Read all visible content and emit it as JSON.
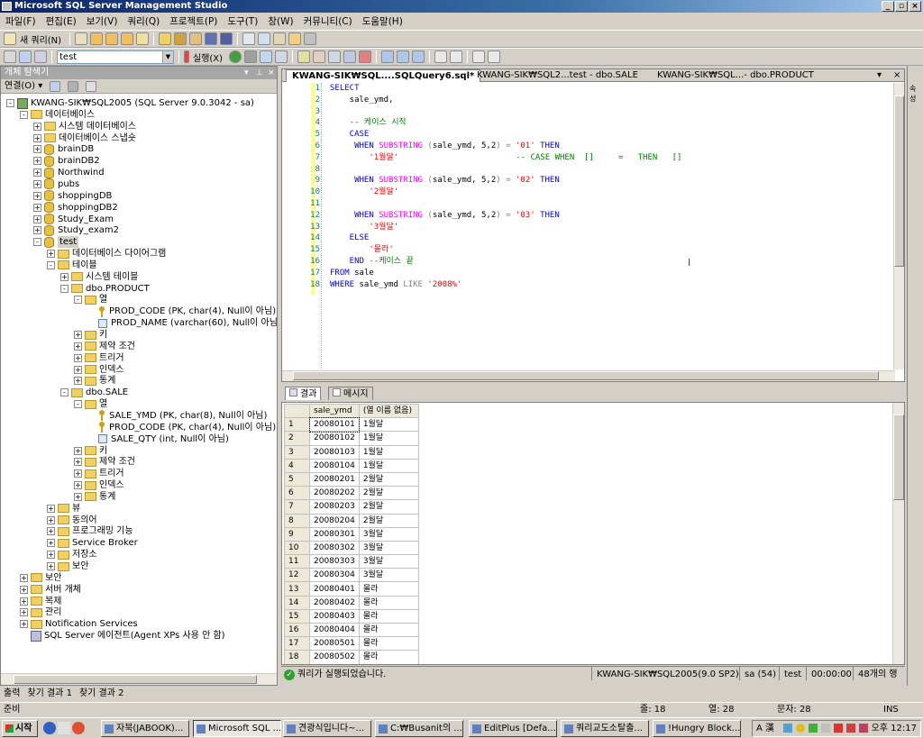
{
  "window": {
    "title": "Microsoft SQL Server Management Studio"
  },
  "menu": [
    "파일(F)",
    "편집(E)",
    "보기(V)",
    "쿼리(Q)",
    "프로젝트(P)",
    "도구(T)",
    "창(W)",
    "커뮤니티(C)",
    "도움말(H)"
  ],
  "toolbar1": {
    "new_query": "새 쿼리(N)"
  },
  "toolbar2": {
    "database": "test",
    "execute": "실행(X)"
  },
  "object_explorer": {
    "title": "개체 탐색기",
    "connect": "연결(O)",
    "tree": [
      {
        "label": "KWANG-SIK₩SQL2005 (SQL Server 9.0.3042 - sa)",
        "level": 0,
        "icon": "server-icon",
        "exp": "-"
      },
      {
        "label": "데이터베이스",
        "level": 1,
        "icon": "folder-icon",
        "exp": "-"
      },
      {
        "label": "시스템 데이터베이스",
        "level": 2,
        "icon": "folder-icon",
        "exp": "+"
      },
      {
        "label": "데이터베이스 스냅숏",
        "level": 2,
        "icon": "folder-icon",
        "exp": "+"
      },
      {
        "label": "brainDB",
        "level": 2,
        "icon": "database-icon",
        "exp": "+"
      },
      {
        "label": "brainDB2",
        "level": 2,
        "icon": "database-icon",
        "exp": "+"
      },
      {
        "label": "Northwind",
        "level": 2,
        "icon": "database-icon",
        "exp": "+"
      },
      {
        "label": "pubs",
        "level": 2,
        "icon": "database-icon",
        "exp": "+"
      },
      {
        "label": "shoppingDB",
        "level": 2,
        "icon": "database-icon",
        "exp": "+"
      },
      {
        "label": "shoppingDB2",
        "level": 2,
        "icon": "database-icon",
        "exp": "+"
      },
      {
        "label": "Study_Exam",
        "level": 2,
        "icon": "database-icon",
        "exp": "+"
      },
      {
        "label": "Study_exam2",
        "level": 2,
        "icon": "database-icon",
        "exp": "+"
      },
      {
        "label": "test",
        "level": 2,
        "icon": "database-icon",
        "exp": "-",
        "selected": true
      },
      {
        "label": "데이터베이스 다이어그램",
        "level": 3,
        "icon": "folder-icon",
        "exp": "+"
      },
      {
        "label": "테이블",
        "level": 3,
        "icon": "folder-icon",
        "exp": "-"
      },
      {
        "label": "시스템 테이블",
        "level": 4,
        "icon": "folder-icon",
        "exp": "+"
      },
      {
        "label": "dbo.PRODUCT",
        "level": 4,
        "icon": "table-icon",
        "exp": "-"
      },
      {
        "label": "열",
        "level": 5,
        "icon": "folder-icon",
        "exp": "-"
      },
      {
        "label": "PROD_CODE (PK, char(4), Null이 아님)",
        "level": 6,
        "icon": "key-icon",
        "exp": ""
      },
      {
        "label": "PROD_NAME (varchar(60), Null이 아님)",
        "level": 6,
        "icon": "column-icon",
        "exp": ""
      },
      {
        "label": "키",
        "level": 5,
        "icon": "folder-icon",
        "exp": "+"
      },
      {
        "label": "제약 조건",
        "level": 5,
        "icon": "folder-icon",
        "exp": "+"
      },
      {
        "label": "트리거",
        "level": 5,
        "icon": "folder-icon",
        "exp": "+"
      },
      {
        "label": "인덱스",
        "level": 5,
        "icon": "folder-icon",
        "exp": "+"
      },
      {
        "label": "통계",
        "level": 5,
        "icon": "folder-icon",
        "exp": "+"
      },
      {
        "label": "dbo.SALE",
        "level": 4,
        "icon": "table-icon",
        "exp": "-"
      },
      {
        "label": "열",
        "level": 5,
        "icon": "folder-icon",
        "exp": "-"
      },
      {
        "label": "SALE_YMD (PK, char(8), Null이 아님)",
        "level": 6,
        "icon": "key-icon",
        "exp": ""
      },
      {
        "label": "PROD_CODE (PK, char(4), Null이 아님)",
        "level": 6,
        "icon": "key-icon",
        "exp": ""
      },
      {
        "label": "SALE_QTY (int, Null이 아님)",
        "level": 6,
        "icon": "column-icon",
        "exp": ""
      },
      {
        "label": "키",
        "level": 5,
        "icon": "folder-icon",
        "exp": "+"
      },
      {
        "label": "제약 조건",
        "level": 5,
        "icon": "folder-icon",
        "exp": "+"
      },
      {
        "label": "트리거",
        "level": 5,
        "icon": "folder-icon",
        "exp": "+"
      },
      {
        "label": "인덱스",
        "level": 5,
        "icon": "folder-icon",
        "exp": "+"
      },
      {
        "label": "통계",
        "level": 5,
        "icon": "folder-icon",
        "exp": "+"
      },
      {
        "label": "뷰",
        "level": 3,
        "icon": "folder-icon",
        "exp": "+"
      },
      {
        "label": "동의어",
        "level": 3,
        "icon": "folder-icon",
        "exp": "+"
      },
      {
        "label": "프로그래밍 기능",
        "level": 3,
        "icon": "folder-icon",
        "exp": "+"
      },
      {
        "label": "Service Broker",
        "level": 3,
        "icon": "folder-icon",
        "exp": "+"
      },
      {
        "label": "저장소",
        "level": 3,
        "icon": "folder-icon",
        "exp": "+"
      },
      {
        "label": "보안",
        "level": 3,
        "icon": "folder-icon",
        "exp": "+"
      },
      {
        "label": "보안",
        "level": 1,
        "icon": "folder-icon",
        "exp": "+"
      },
      {
        "label": "서버 개체",
        "level": 1,
        "icon": "folder-icon",
        "exp": "+"
      },
      {
        "label": "복제",
        "level": 1,
        "icon": "folder-icon",
        "exp": "+"
      },
      {
        "label": "관리",
        "level": 1,
        "icon": "folder-icon",
        "exp": "+"
      },
      {
        "label": "Notification Services",
        "level": 1,
        "icon": "folder-icon",
        "exp": "+"
      },
      {
        "label": "SQL Server 에이전트(Agent XPs 사용 안 함)",
        "level": 1,
        "icon": "agent-icon",
        "exp": ""
      }
    ]
  },
  "editor": {
    "tabs": [
      "KWANG-SIK₩SQL....SQLQuery6.sql*",
      "KWANG-SIK₩SQL2...test - dbo.SALE",
      "KWANG-SIK₩SQL...- dbo.PRODUCT"
    ],
    "lines": [
      [
        [
          "kw",
          "SELECT"
        ]
      ],
      [
        [
          "",
          "    sale_ymd,"
        ]
      ],
      [
        [
          "",
          ""
        ]
      ],
      [
        [
          "cm",
          "    -- 케이스 시작"
        ]
      ],
      [
        [
          "kw",
          "    CASE"
        ]
      ],
      [
        [
          "kw",
          "     WHEN "
        ],
        [
          "fn",
          "SUBSTRING"
        ],
        [
          "",
          " "
        ],
        [
          "gr",
          "("
        ],
        [
          "",
          "sale_ymd, 5,2"
        ],
        [
          "gr",
          ")"
        ],
        [
          "",
          " "
        ],
        [
          "gr",
          "="
        ],
        [
          "",
          " "
        ],
        [
          "str",
          "'01'"
        ],
        [
          "",
          " "
        ],
        [
          "kw",
          "THEN"
        ]
      ],
      [
        [
          "str",
          "        '1월달'"
        ],
        [
          "",
          "                        "
        ],
        [
          "cm",
          "-- CASE WHEN  []     =   THEN   []"
        ]
      ],
      [
        [
          "",
          ""
        ]
      ],
      [
        [
          "kw",
          "     WHEN "
        ],
        [
          "fn",
          "SUBSTRING"
        ],
        [
          "",
          " "
        ],
        [
          "gr",
          "("
        ],
        [
          "",
          "sale_ymd, 5,2"
        ],
        [
          "gr",
          ")"
        ],
        [
          "",
          " "
        ],
        [
          "gr",
          "="
        ],
        [
          "",
          " "
        ],
        [
          "str",
          "'02'"
        ],
        [
          "",
          " "
        ],
        [
          "kw",
          "THEN"
        ]
      ],
      [
        [
          "str",
          "        '2월달'"
        ]
      ],
      [
        [
          "",
          ""
        ]
      ],
      [
        [
          "kw",
          "     WHEN "
        ],
        [
          "fn",
          "SUBSTRING"
        ],
        [
          "",
          " "
        ],
        [
          "gr",
          "("
        ],
        [
          "",
          "sale_ymd, 5,2"
        ],
        [
          "gr",
          ")"
        ],
        [
          "",
          " "
        ],
        [
          "gr",
          "="
        ],
        [
          "",
          " "
        ],
        [
          "str",
          "'03'"
        ],
        [
          "",
          " "
        ],
        [
          "kw",
          "THEN"
        ]
      ],
      [
        [
          "str",
          "        '3월달'"
        ]
      ],
      [
        [
          "kw",
          "    ELSE"
        ]
      ],
      [
        [
          "str",
          "        '몰라'"
        ]
      ],
      [
        [
          "kw",
          "    END "
        ],
        [
          "cm",
          "--케이스 끝"
        ]
      ],
      [
        [
          "kw",
          "FROM"
        ],
        [
          "",
          " sale"
        ]
      ],
      [
        [
          "kw",
          "WHERE"
        ],
        [
          "",
          " sale_ymd "
        ],
        [
          "gr",
          "LIKE"
        ],
        [
          "",
          " "
        ],
        [
          "str",
          "'2008%'"
        ]
      ]
    ]
  },
  "results": {
    "tabs": [
      "결과",
      "메시지"
    ],
    "columns": [
      "sale_ymd",
      "(열 이름 없음)"
    ],
    "rows": [
      [
        "1",
        "20080101",
        "1월달"
      ],
      [
        "2",
        "20080102",
        "1월달"
      ],
      [
        "3",
        "20080103",
        "1월달"
      ],
      [
        "4",
        "20080104",
        "1월달"
      ],
      [
        "5",
        "20080201",
        "2월달"
      ],
      [
        "6",
        "20080202",
        "2월달"
      ],
      [
        "7",
        "20080203",
        "2월달"
      ],
      [
        "8",
        "20080204",
        "2월달"
      ],
      [
        "9",
        "20080301",
        "3월달"
      ],
      [
        "10",
        "20080302",
        "3월달"
      ],
      [
        "11",
        "20080303",
        "3월달"
      ],
      [
        "12",
        "20080304",
        "3월달"
      ],
      [
        "13",
        "20080401",
        "몰라"
      ],
      [
        "14",
        "20080402",
        "몰라"
      ],
      [
        "15",
        "20080403",
        "몰라"
      ],
      [
        "16",
        "20080404",
        "몰라"
      ],
      [
        "17",
        "20080501",
        "몰라"
      ],
      [
        "18",
        "20080502",
        "몰라"
      ]
    ]
  },
  "query_status": {
    "message": "쿼리가 실행되었습니다.",
    "server": "KWANG-SIK₩SQL2005(9.0 SP2)",
    "user": "sa (54)",
    "database": "test",
    "elapsed": "00:00:00",
    "row_count": "48개의 행"
  },
  "bottom_tabs": [
    "출력",
    "찾기 결과 1",
    "찾기 결과 2"
  ],
  "statusbar": {
    "ready": "준비",
    "line": "줄: 18",
    "col": "열: 28",
    "char": "문자: 28",
    "mode": "INS"
  },
  "taskbar": {
    "start": "시작",
    "tasks": [
      "자북(JABOOK)...",
      "Microsoft SQL ...",
      "견광식입니다~...",
      "C:₩Busanit의 ...",
      "EditPlus [Defa...",
      "쿼리교도소탈출...",
      "!Hungry Block..."
    ],
    "clock": "오후 12:17",
    "tray_text": "A 漢"
  },
  "right_panel": {
    "label": "속성"
  }
}
